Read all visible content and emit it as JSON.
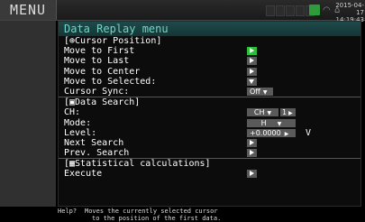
{
  "header": {
    "menu_label": "MENU",
    "date": "2015-04-17",
    "time": "14:19:43"
  },
  "panel": {
    "title": "Data Replay menu",
    "cursor_section": {
      "title": "[⊕Cursor Position]",
      "items": [
        {
          "label": "Move to First"
        },
        {
          "label": "Move to Last"
        },
        {
          "label": "Move to Center"
        },
        {
          "label": "Move to Selected:"
        },
        {
          "label": "Cursor Sync:",
          "value": "Off"
        }
      ]
    },
    "search_section": {
      "title": "[▣Data Search]",
      "ch_label": "CH:",
      "ch_value": "CH",
      "ch_num": "1",
      "mode_label": "Mode:",
      "mode_value": "H",
      "level_label": "Level:",
      "level_value": "+0.0000",
      "level_unit": "V",
      "next_label": "Next Search",
      "prev_label": "Prev. Search"
    },
    "stats_section": {
      "title": "[▦Statistical calculations]",
      "execute_label": "Execute"
    }
  },
  "help": {
    "label": "Help?",
    "line1": "Moves the currently selected cursor",
    "line2": "to the position of the first data."
  },
  "colors": {
    "accent_green": "#2dbf3a",
    "title_teal": "#6fd6c8"
  }
}
